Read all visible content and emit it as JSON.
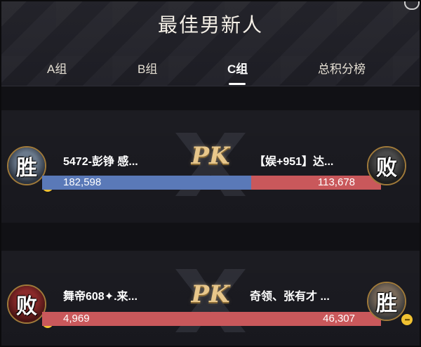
{
  "header": {
    "title": "最佳男新人"
  },
  "tabs": [
    {
      "label": "A组"
    },
    {
      "label": "B组"
    },
    {
      "label": "C组"
    },
    {
      "label": "总积分榜"
    }
  ],
  "active_tab": "C组",
  "matches": [
    {
      "pk_label": "PK",
      "left": {
        "name": "5472-彭铮 感...",
        "score": "182,598",
        "result": "胜"
      },
      "right": {
        "name": "【娱+951】达...",
        "score": "113,678",
        "result": "败"
      },
      "left_share": 0.616
    },
    {
      "pk_label": "PK",
      "left": {
        "name": "舞帝608✦.来...",
        "score": "4,969",
        "result": "败"
      },
      "right": {
        "name": "奇领、张有才 ...",
        "score": "46,307",
        "result": "胜"
      },
      "left_share": 0.097
    }
  ],
  "colors": {
    "left_bar": "#5a79b8",
    "right_bar": "#c9585b",
    "pk_gold": "#e8c78b"
  }
}
